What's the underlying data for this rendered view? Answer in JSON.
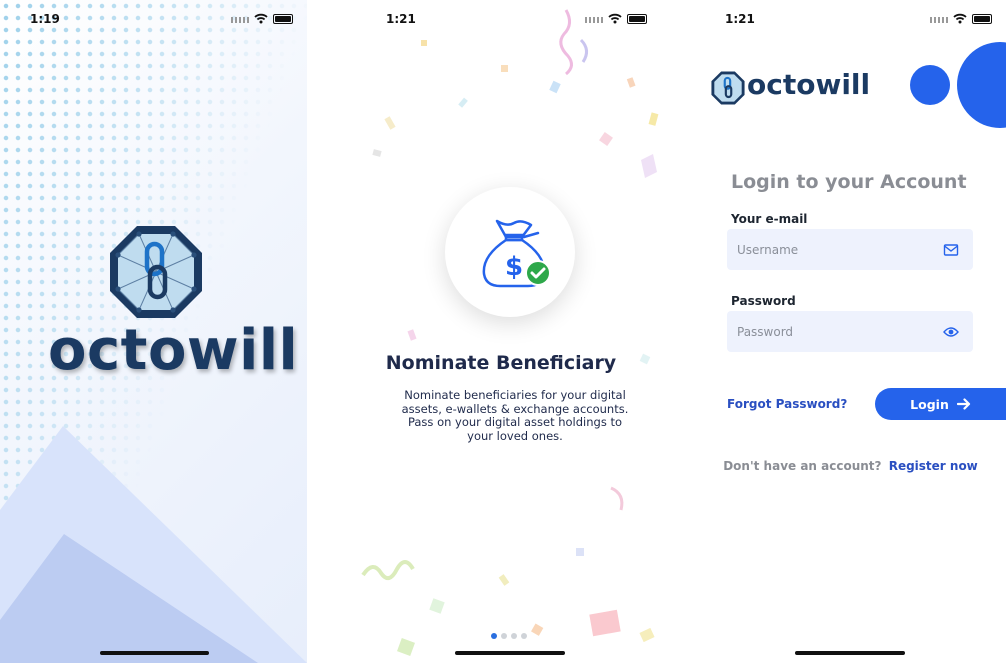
{
  "screens": [
    {
      "status_time": "1:19"
    },
    {
      "status_time": "1:21"
    },
    {
      "status_time": "1:21"
    }
  ],
  "splash": {
    "brand": "octowill"
  },
  "onboarding": {
    "title": "Nominate Beneficiary",
    "description": "Nominate beneficiaries for your digital assets, e-wallets & exchange accounts. Pass on your digital asset holdings to your loved ones.",
    "page_count": 4,
    "active_page": 1
  },
  "login": {
    "brand": "octowill",
    "title": "Login to your Account",
    "email_label": "Your e-mail",
    "email_placeholder": "Username",
    "password_label": "Password",
    "password_placeholder": "Password",
    "forgot_label": "Forgot Password?",
    "login_label": "Login",
    "register_prompt": "Don't have an account?",
    "register_link": "Register now"
  },
  "colors": {
    "brand_blue": "#2563eb",
    "navy": "#1b3a62",
    "link_blue": "#2a4fc1",
    "check_green": "#2ea84a"
  },
  "icons": {
    "email": "envelope-icon",
    "password": "eye-icon",
    "login": "arrow-right-icon",
    "beneficiary": "money-bag-check-icon"
  }
}
